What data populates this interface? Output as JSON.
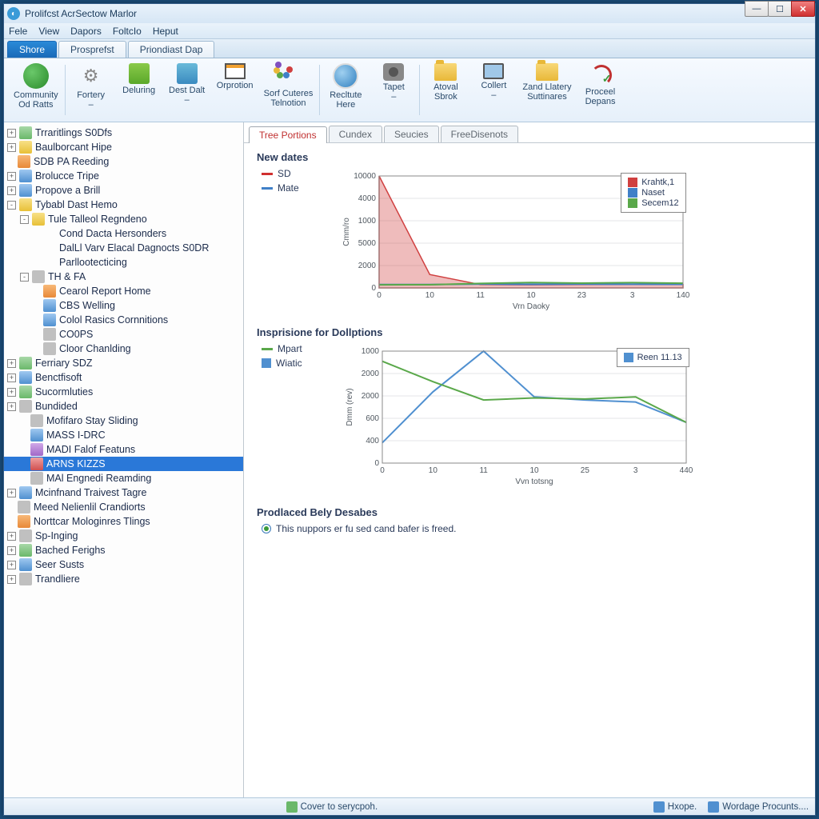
{
  "window": {
    "title": "Prolifcst AcrSectow Marlor"
  },
  "menubar": [
    "Fele",
    "View",
    "Dapors",
    "FoltcIo",
    "Heput"
  ],
  "maintabs": [
    {
      "label": "Shore",
      "active": true
    },
    {
      "label": "Prosprefst",
      "active": false
    },
    {
      "label": "Priondiast Dap",
      "active": false
    }
  ],
  "ribbon": [
    {
      "name": "community-od-ratts",
      "label": "Community\nOd Ratts",
      "icon": "globe"
    },
    {
      "name": "fortery",
      "label": "Fortery\n–",
      "icon": "gear"
    },
    {
      "name": "deluring",
      "label": "Deluring",
      "icon": "box1"
    },
    {
      "name": "dest-dalt",
      "label": "Dest Dalt\n–",
      "icon": "box2"
    },
    {
      "name": "orprotion",
      "label": "Orprotion",
      "icon": "win"
    },
    {
      "name": "sorf-cuteres",
      "label": "Sorf Cuteres\nTelnotion",
      "icon": "balls"
    },
    {
      "name": "recltute-here",
      "label": "Recltute\nHere",
      "icon": "disc"
    },
    {
      "name": "tapet",
      "label": "Tapet\n–",
      "icon": "cam"
    },
    {
      "name": "atoval-sbrok",
      "label": "Atoval\nSbrok",
      "icon": "folder"
    },
    {
      "name": "collert",
      "label": "Collert\n–",
      "icon": "mon"
    },
    {
      "name": "zand-llatery",
      "label": "Zand Llatery\nSuttinares",
      "icon": "folder"
    },
    {
      "name": "proceel-depans",
      "label": "Proceel\nDepans",
      "icon": "arrow"
    }
  ],
  "tree": [
    {
      "d": 0,
      "exp": "+",
      "ic": "ic-c",
      "label": "Trraritlings S0Dfs"
    },
    {
      "d": 0,
      "exp": "+",
      "ic": "ic-y",
      "label": "Baulborcant Hipe"
    },
    {
      "d": 0,
      "exp": "",
      "ic": "ic-o",
      "label": "SDB PA Reeding"
    },
    {
      "d": 0,
      "exp": "+",
      "ic": "ic-b",
      "label": "Brolucce Tripe"
    },
    {
      "d": 0,
      "exp": "+",
      "ic": "ic-b",
      "label": "Propove a Brill"
    },
    {
      "d": 0,
      "exp": "-",
      "ic": "ic-y",
      "label": "Tybabl Dast Hemo"
    },
    {
      "d": 1,
      "exp": "-",
      "ic": "ic-y",
      "label": "Tule Talleol Regndeno"
    },
    {
      "d": 2,
      "exp": "",
      "ic": "",
      "label": "Cond Dacta Hersonders"
    },
    {
      "d": 2,
      "exp": "",
      "ic": "",
      "label": "DalLl Varv Elacal Dagnocts S0DR"
    },
    {
      "d": 2,
      "exp": "",
      "ic": "",
      "label": "Parllootecticing"
    },
    {
      "d": 1,
      "exp": "-",
      "ic": "ic-g",
      "label": "TH & FA"
    },
    {
      "d": 2,
      "exp": "",
      "ic": "ic-o",
      "label": "Cearol Report Home"
    },
    {
      "d": 2,
      "exp": "",
      "ic": "ic-b",
      "label": "CBS Welling"
    },
    {
      "d": 2,
      "exp": "",
      "ic": "ic-b",
      "label": "Colol Rasics Cornnitions"
    },
    {
      "d": 2,
      "exp": "",
      "ic": "ic-g",
      "label": "CO0PS"
    },
    {
      "d": 2,
      "exp": "",
      "ic": "ic-g",
      "label": "Cloor Chanlding"
    },
    {
      "d": 0,
      "exp": "+",
      "ic": "ic-c",
      "label": "Ferriary SDZ"
    },
    {
      "d": 0,
      "exp": "+",
      "ic": "ic-b",
      "label": "Benctfisoft"
    },
    {
      "d": 0,
      "exp": "+",
      "ic": "ic-c",
      "label": "Sucormluties"
    },
    {
      "d": 0,
      "exp": "+",
      "ic": "ic-g",
      "label": "Bundided"
    },
    {
      "d": 1,
      "exp": "",
      "ic": "ic-g",
      "label": "Mofifaro Stay Sliding"
    },
    {
      "d": 1,
      "exp": "",
      "ic": "ic-b",
      "label": "MASS I-DRC"
    },
    {
      "d": 1,
      "exp": "",
      "ic": "ic-p",
      "label": "MADI Falof Featuns"
    },
    {
      "d": 1,
      "exp": "",
      "ic": "ic-r",
      "label": "ARNS KIZZS",
      "sel": true
    },
    {
      "d": 1,
      "exp": "",
      "ic": "ic-g",
      "label": "MAl Engnedi Reamding"
    },
    {
      "d": 0,
      "exp": "+",
      "ic": "ic-b",
      "label": "Mcinfnand Traivest Tagre"
    },
    {
      "d": 0,
      "exp": "",
      "ic": "ic-g",
      "label": "Meed Nelienlil Crandiorts"
    },
    {
      "d": 0,
      "exp": "",
      "ic": "ic-o",
      "label": "Norttcar Mologinres Tlings"
    },
    {
      "d": 0,
      "exp": "+",
      "ic": "ic-g",
      "label": "Sp-Inging"
    },
    {
      "d": 0,
      "exp": "+",
      "ic": "ic-c",
      "label": "Bached Ferighs"
    },
    {
      "d": 0,
      "exp": "+",
      "ic": "ic-b",
      "label": "Seer Susts"
    },
    {
      "d": 0,
      "exp": "+",
      "ic": "ic-g",
      "label": "Trandliere"
    }
  ],
  "ctabs": [
    {
      "label": "Tree Portions",
      "active": true
    },
    {
      "label": "Cundex",
      "active": false
    },
    {
      "label": "Seucies",
      "active": false
    },
    {
      "label": "FreeDisenots",
      "active": false
    }
  ],
  "section1": {
    "title": "New dates",
    "inline_legend": [
      {
        "color": "#d03030",
        "label": "SD"
      },
      {
        "color": "#4080c8",
        "label": "Mate"
      }
    ]
  },
  "section2": {
    "title": "Insprisione for Dollptions",
    "inline_legend": [
      {
        "color": "#5aa84a",
        "label": "Mpart"
      },
      {
        "color": "#5090d0",
        "label": "Wiatic",
        "sq": true
      }
    ]
  },
  "section3": {
    "title": "Prodlaced Bely Desabes",
    "radio_text": "This nuppors er fu sed cand bafer is freed."
  },
  "chart_data": [
    {
      "type": "area",
      "title": "",
      "xlabel": "Vrn Daoky",
      "ylabel": "Cmm/ro",
      "x": [
        0,
        10,
        11,
        10,
        23,
        3,
        140
      ],
      "yticks": [
        0,
        2000,
        5000,
        1000,
        4000,
        10000
      ],
      "series": [
        {
          "name": "Krahtk,1",
          "color": "#d04040",
          "values": [
            10000,
            1200,
            300,
            280,
            300,
            320,
            300
          ]
        },
        {
          "name": "Naset",
          "color": "#4080c8",
          "values": [
            300,
            300,
            350,
            320,
            340,
            330,
            320
          ]
        },
        {
          "name": "Secem12",
          "color": "#5aa84a",
          "values": [
            280,
            290,
            400,
            480,
            430,
            470,
            420
          ]
        }
      ],
      "legend_pos": "top-right"
    },
    {
      "type": "line",
      "title": "",
      "xlabel": "Vvn totsng",
      "ylabel": "Dmm (rev)",
      "x": [
        0,
        10,
        11,
        10,
        25,
        3,
        440
      ],
      "yticks": [
        0,
        400,
        600,
        2000,
        2000,
        1000
      ],
      "series": [
        {
          "name": "Reen 11.13",
          "color": "#5090d0",
          "values": [
            200,
            700,
            1100,
            650,
            620,
            600,
            400
          ]
        },
        {
          "name": "",
          "color": "#5aa84a",
          "values": [
            1000,
            800,
            620,
            640,
            630,
            650,
            400
          ]
        }
      ],
      "legend_pos": "top-right"
    }
  ],
  "status": {
    "center": "Cover to serycpoh.",
    "right1": "Hxope.",
    "right2": "Wordage Procunts...."
  }
}
